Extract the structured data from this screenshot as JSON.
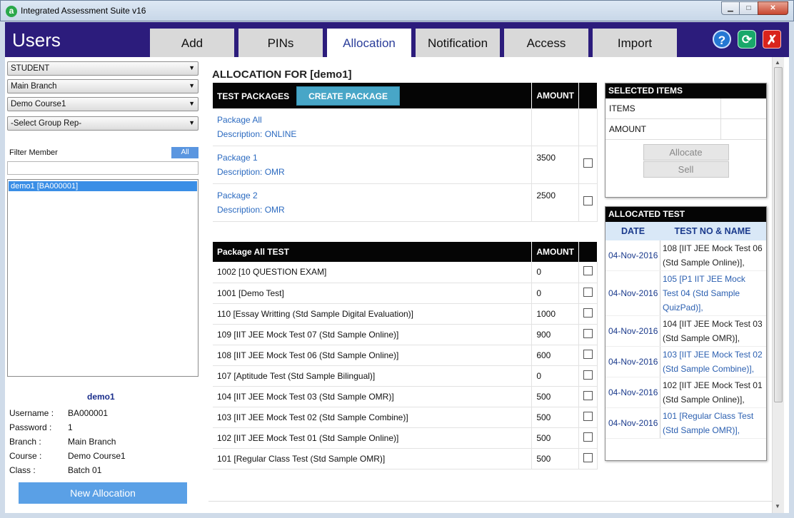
{
  "window": {
    "app_title": "Integrated Assessment Suite v16",
    "icon_letter": "a",
    "min_glyph": "▁",
    "max_glyph": "□",
    "close_glyph": "✕"
  },
  "header": {
    "title": "Users",
    "tabs": [
      "Add",
      "PINs",
      "Allocation",
      "Notification",
      "Access",
      "Import"
    ],
    "active_tab": "Allocation",
    "help_glyph": "?",
    "refresh_glyph": "⟳",
    "exit_glyph": "✗"
  },
  "left": {
    "selects": [
      "STUDENT",
      "Main Branch",
      "Demo Course1",
      "-Select Group Rep-"
    ],
    "filter_label": "Filter Member",
    "all_label": "All",
    "filter_value": "",
    "members": [
      "demo1 [BA000001]"
    ],
    "selected_member_name": "demo1",
    "info": [
      {
        "label": "Username :",
        "value": "BA000001"
      },
      {
        "label": "Password :",
        "value": "1"
      },
      {
        "label": "Branch :",
        "value": "Main Branch"
      },
      {
        "label": "Course :",
        "value": "Demo Course1"
      },
      {
        "label": "Class :",
        "value": "Batch 01"
      }
    ],
    "new_allocation_label": "New Allocation"
  },
  "main": {
    "title": "ALLOCATION FOR [demo1]",
    "packages_header": "TEST PACKAGES",
    "create_package_label": "CREATE PACKAGE",
    "amount_header": "AMOUNT",
    "packages": [
      {
        "name": "Package All",
        "description": "Description: ONLINE",
        "amount": "",
        "has_checkbox": false
      },
      {
        "name": "Package 1",
        "description": "Description: OMR",
        "amount": "3500",
        "has_checkbox": true
      },
      {
        "name": "Package 2",
        "description": "Description: OMR",
        "amount": "2500",
        "has_checkbox": true
      }
    ],
    "tests_header": "Package All TEST",
    "tests_amount_header": "AMOUNT",
    "tests": [
      {
        "name": "1002 [10 QUESTION EXAM]",
        "amount": "0"
      },
      {
        "name": "1001 [Demo Test]",
        "amount": "0"
      },
      {
        "name": "110 [Essay Writting (Std Sample Digital Evaluation)]",
        "amount": "1000"
      },
      {
        "name": "109 [IIT JEE Mock Test 07 (Std Sample Online)]",
        "amount": "900"
      },
      {
        "name": "108 [IIT JEE Mock Test 06 (Std Sample Online)]",
        "amount": "600"
      },
      {
        "name": "107 [Aptitude Test (Std Sample Bilingual)]",
        "amount": "0"
      },
      {
        "name": "104 [IIT JEE Mock Test 03 (Std Sample OMR)]",
        "amount": "500"
      },
      {
        "name": "103 [IIT JEE Mock Test 02 (Std Sample Combine)]",
        "amount": "500"
      },
      {
        "name": "102 [IIT JEE Mock Test 01 (Std Sample Online)]",
        "amount": "500"
      },
      {
        "name": "101 [Regular Class Test (Std Sample OMR)]",
        "amount": "500"
      }
    ]
  },
  "selected_items": {
    "title": "SELECTED ITEMS",
    "items_label": "ITEMS",
    "items_value": "",
    "amount_label": "AMOUNT",
    "amount_value": "",
    "allocate_label": "Allocate",
    "sell_label": "Sell"
  },
  "allocated_test": {
    "title": "ALLOCATED TEST",
    "date_header": "DATE",
    "name_header": "TEST NO & NAME",
    "rows": [
      {
        "date": "04-Nov-2016",
        "name": "108 [IIT JEE Mock Test 06 (Std Sample Online)],",
        "color": "#222222"
      },
      {
        "date": "04-Nov-2016",
        "name": "105 [P1 IIT JEE Mock Test 04 (Std Sample QuizPad)],",
        "color": "#2b5fb0"
      },
      {
        "date": "04-Nov-2016",
        "name": "104 [IIT JEE Mock Test 03 (Std Sample OMR)],",
        "color": "#222222"
      },
      {
        "date": "04-Nov-2016",
        "name": "103 [IIT JEE Mock Test 02 (Std Sample Combine)],",
        "color": "#2b5fb0"
      },
      {
        "date": "04-Nov-2016",
        "name": "102 [IIT JEE Mock Test 01 (Std Sample Online)],",
        "color": "#222222"
      },
      {
        "date": "04-Nov-2016",
        "name": "101 [Regular Class Test (Std Sample OMR)],",
        "color": "#2b5fb0"
      }
    ]
  },
  "colors": {
    "header_bg": "#2c1c7c",
    "accent": "#5aa0e6",
    "create_btn": "#48a6c7"
  }
}
